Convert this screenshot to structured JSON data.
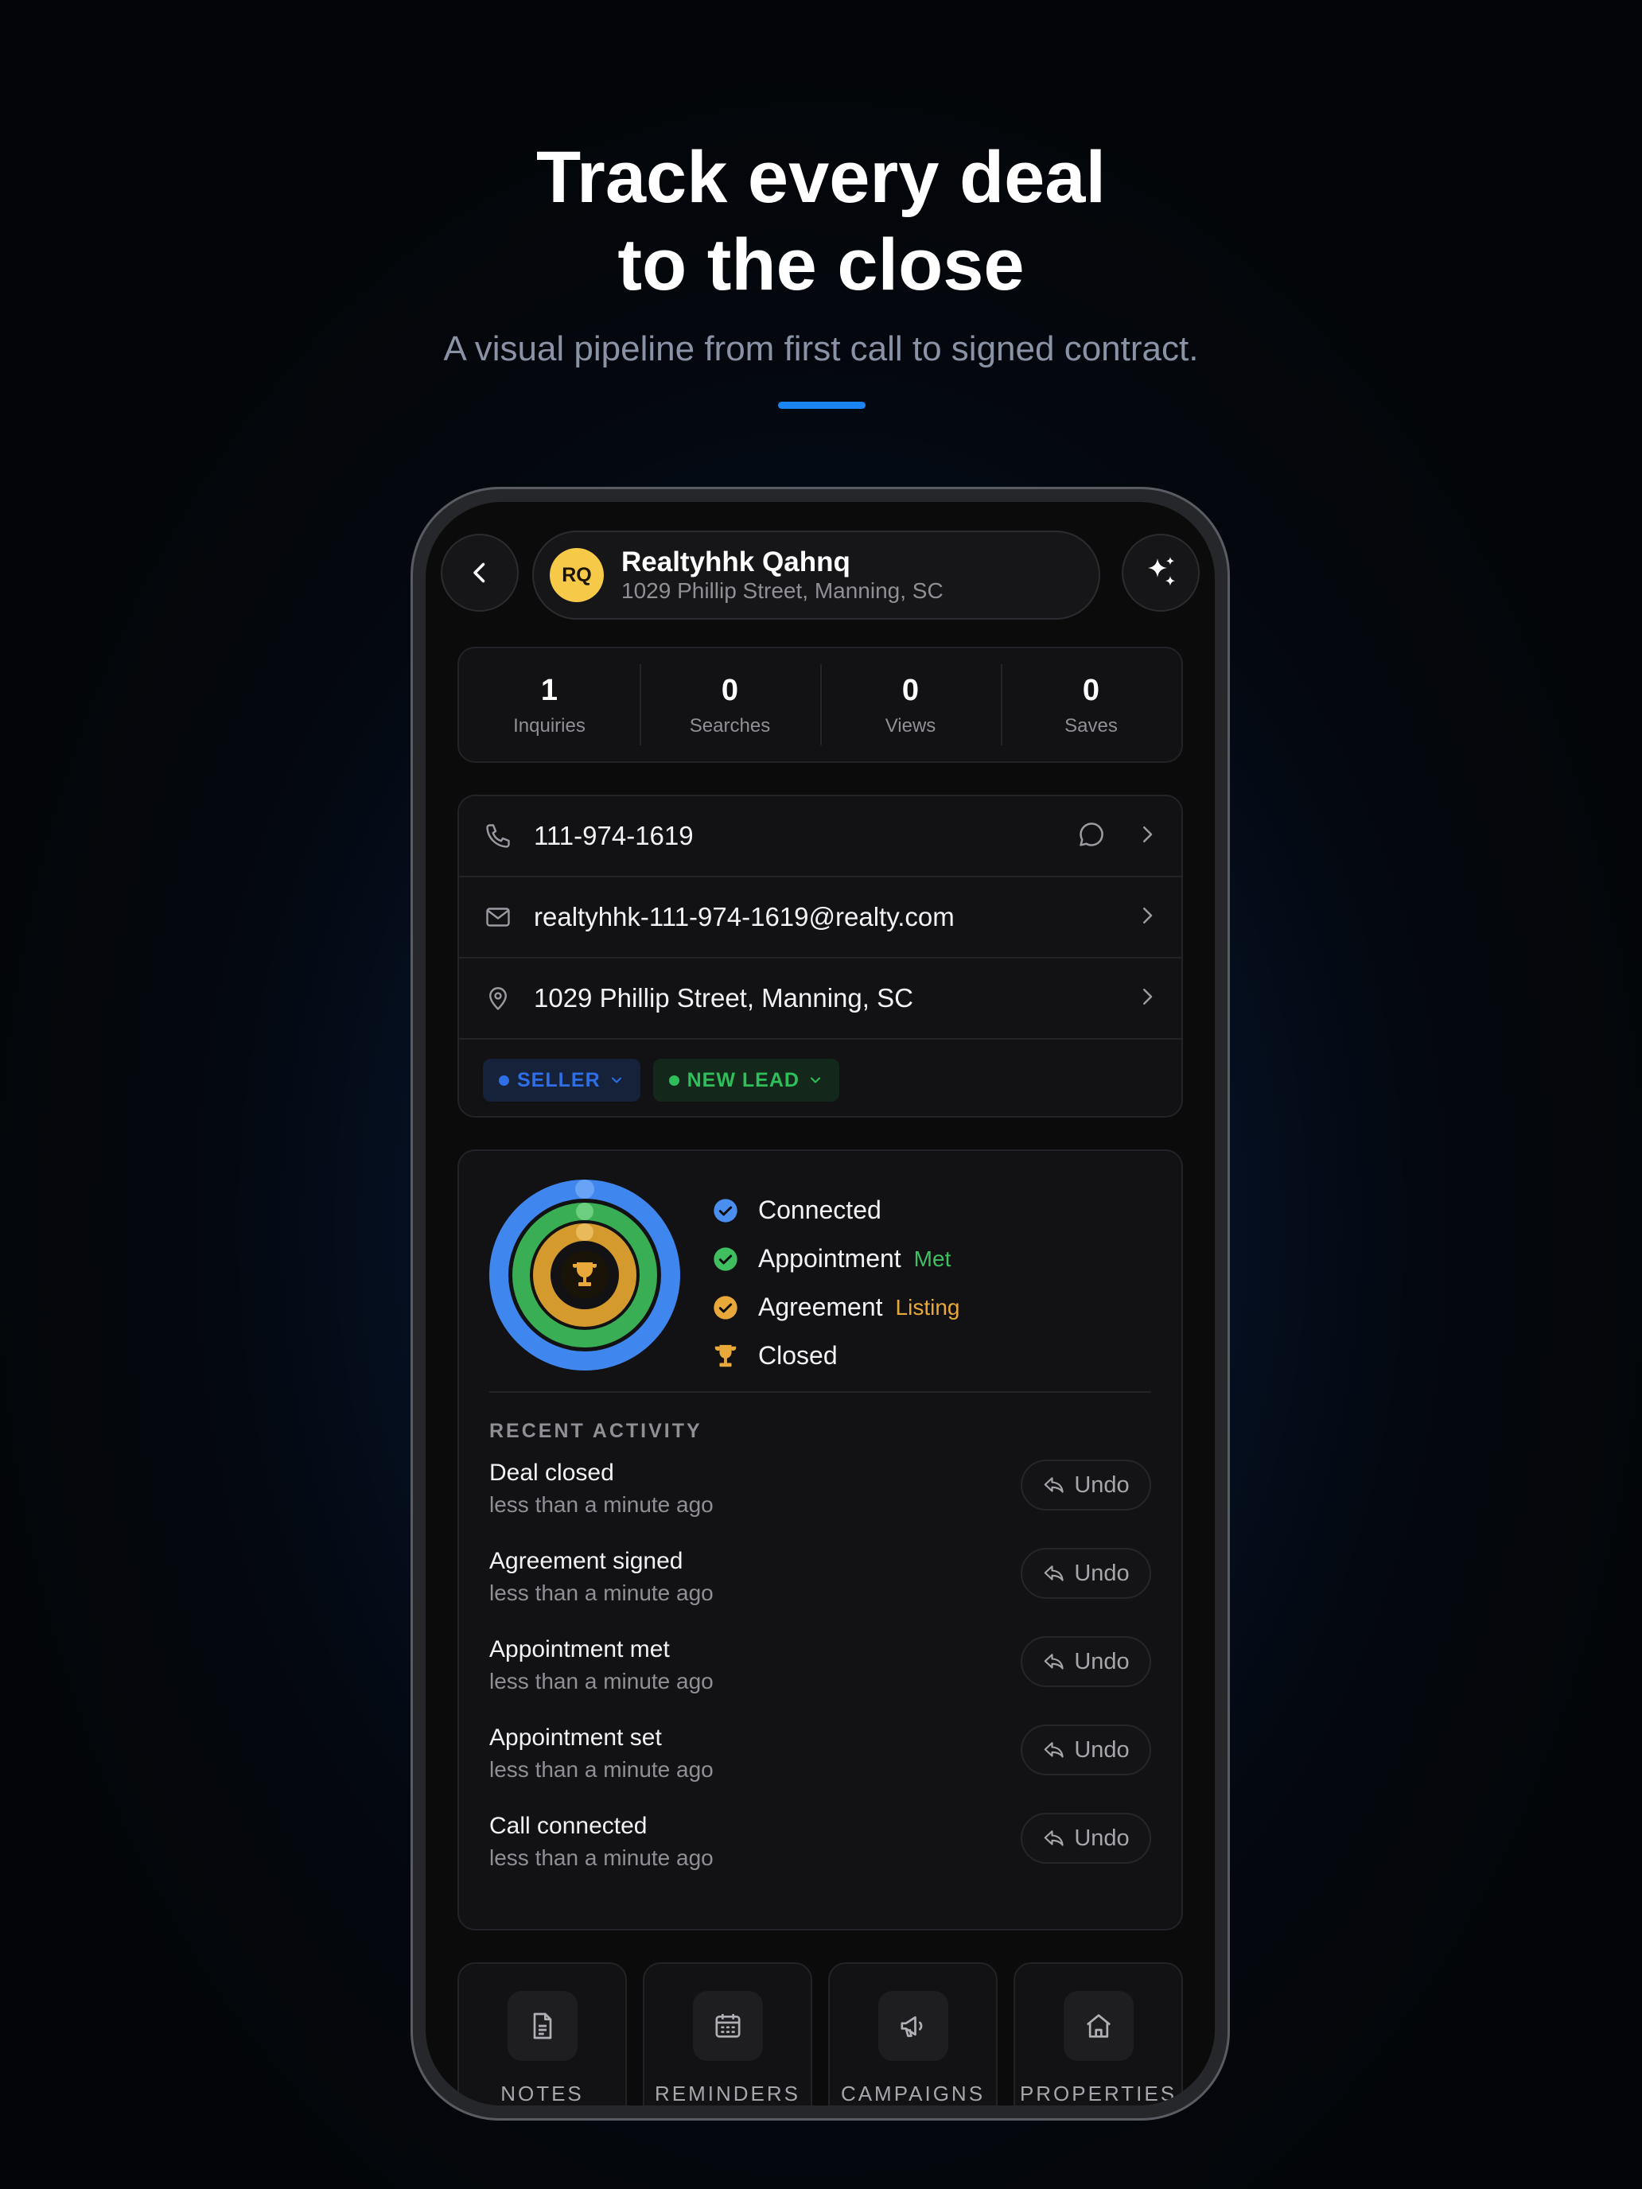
{
  "hero": {
    "title_line1": "Track every deal",
    "title_line2": "to the close",
    "subtitle": "A visual pipeline from first call to signed contract."
  },
  "header": {
    "back_icon": "chevron-left-icon",
    "avatar_initials": "RQ",
    "contact_name": "Realtyhhk Qahnq",
    "contact_address": "1029 Phillip Street, Manning, SC",
    "ai_icon": "sparkles-icon"
  },
  "stats": [
    {
      "value": "1",
      "label": "Inquiries"
    },
    {
      "value": "0",
      "label": "Searches"
    },
    {
      "value": "0",
      "label": "Views"
    },
    {
      "value": "0",
      "label": "Saves"
    }
  ],
  "contact_info": {
    "phone": "111-974-1619",
    "email": "realtyhhk-111-974-1619@realty.com",
    "address": "1029 Phillip Street, Manning, SC"
  },
  "tags": {
    "role": "SELLER",
    "status": "NEW LEAD"
  },
  "pipeline": {
    "stages": [
      {
        "label": "Connected",
        "sub": "",
        "color": "#4a8ff0"
      },
      {
        "label": "Appointment",
        "sub": "Met",
        "color": "#3fbf5f"
      },
      {
        "label": "Agreement",
        "sub": "Listing",
        "color": "#e8a93a"
      },
      {
        "label": "Closed",
        "sub": "",
        "color": "#e8a93a"
      }
    ],
    "ring_progress": {
      "connected": 1.0,
      "appointment": 1.0,
      "agreement": 1.0,
      "closed": 1.0
    }
  },
  "recent_activity": {
    "title": "RECENT ACTIVITY",
    "undo_label": "Undo",
    "items": [
      {
        "title": "Deal closed",
        "time": "less than a minute ago"
      },
      {
        "title": "Agreement signed",
        "time": "less than a minute ago"
      },
      {
        "title": "Appointment met",
        "time": "less than a minute ago"
      },
      {
        "title": "Appointment set",
        "time": "less than a minute ago"
      },
      {
        "title": "Call connected",
        "time": "less than a minute ago"
      }
    ]
  },
  "tiles": [
    {
      "label": "NOTES",
      "icon": "document-icon"
    },
    {
      "label": "REMINDERS",
      "icon": "calendar-icon"
    },
    {
      "label": "CAMPAIGNS",
      "icon": "megaphone-icon"
    },
    {
      "label": "PROPERTIES",
      "icon": "house-icon"
    }
  ],
  "colors": {
    "accent": "#1a84f2",
    "seller": "#2e6fe6",
    "new_lead": "#2fbf5a",
    "avatar": "#f7c948"
  }
}
